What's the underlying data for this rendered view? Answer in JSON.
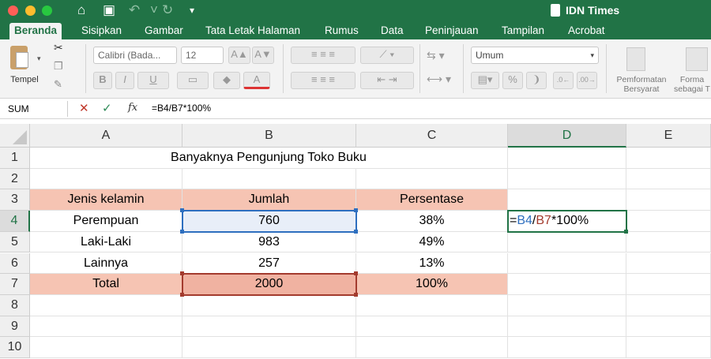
{
  "window": {
    "title": "IDN Times",
    "colors": {
      "accent": "#217346",
      "formula_ref_blue": "#2e6fbf",
      "formula_ref_red": "#a33b2e",
      "header_fill": "#f6c4b3"
    }
  },
  "tabs": [
    "Beranda",
    "Sisipkan",
    "Gambar",
    "Tata Letak Halaman",
    "Rumus",
    "Data",
    "Peninjauan",
    "Tampilan",
    "Acrobat"
  ],
  "ribbon": {
    "paste_label": "Tempel",
    "font_name": "Calibri (Bada...",
    "font_size": "12",
    "bold": "B",
    "italic": "I",
    "underline": "U",
    "number_format": "Umum",
    "percent": "%",
    "conditional_formatting": "Pemformatan Bersyarat",
    "format_as_table": "Forma sebagai T"
  },
  "formula_bar": {
    "name_box": "SUM",
    "fx": "fx",
    "formula": "=B4/B7*100%"
  },
  "columns": [
    "A",
    "B",
    "C",
    "D",
    "E"
  ],
  "rows": [
    "1",
    "2",
    "3",
    "4",
    "5",
    "6",
    "7",
    "8",
    "9",
    "10"
  ],
  "sheet": {
    "title": "Banyaknya Pengunjung Toko Buku",
    "headers": [
      "Jenis kelamin",
      "Jumlah",
      "Persentase"
    ],
    "data": [
      [
        "Perempuan",
        "760",
        "38%"
      ],
      [
        "Laki-Laki",
        "983",
        "49%"
      ],
      [
        "Lainnya",
        "257",
        "13%"
      ],
      [
        "Total",
        "2000",
        "100%"
      ]
    ],
    "edit_cell": {
      "eq": "=",
      "ref1": "B4",
      "slash": "/",
      "ref2": "B7",
      "rest": "*100%"
    }
  }
}
